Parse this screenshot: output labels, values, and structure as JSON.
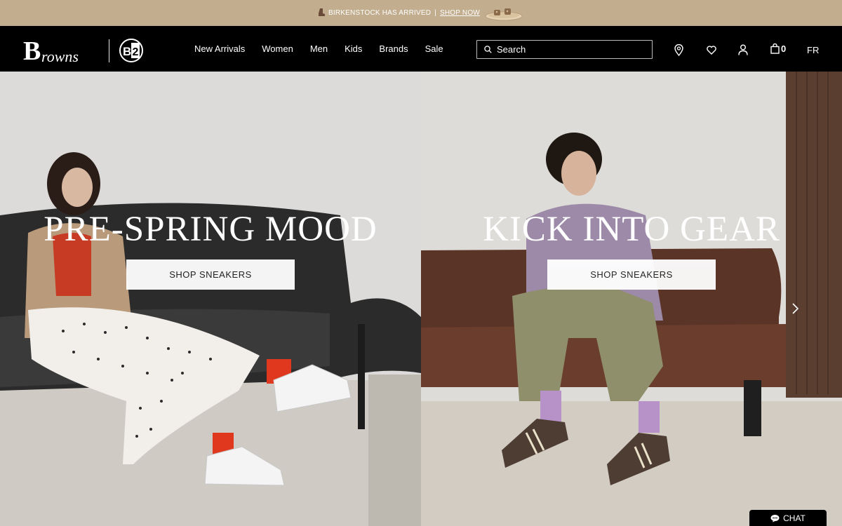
{
  "promo": {
    "text": "BIRKENSTOCK HAS ARRIVED",
    "separator": "|",
    "link": "SHOP NOW"
  },
  "header": {
    "nav": [
      "New Arrivals",
      "Women",
      "Men",
      "Kids",
      "Brands",
      "Sale"
    ],
    "search_placeholder": "Search",
    "cart_count": "0",
    "language": "FR"
  },
  "hero": {
    "left": {
      "headline": "PRE-SPRING MOOD",
      "cta": "SHOP SNEAKERS"
    },
    "right": {
      "headline": "KICK INTO GEAR",
      "cta": "SHOP SNEAKERS"
    }
  },
  "chat": {
    "label": "CHAT"
  },
  "colors": {
    "promo_bg": "#c2ad8f",
    "header_bg": "#000000",
    "accent": "#ffffff"
  },
  "icons": [
    "location-pin-icon",
    "heart-icon",
    "user-icon",
    "shopping-bag-icon",
    "search-icon",
    "chevron-right-icon",
    "chat-bubble-icon"
  ]
}
